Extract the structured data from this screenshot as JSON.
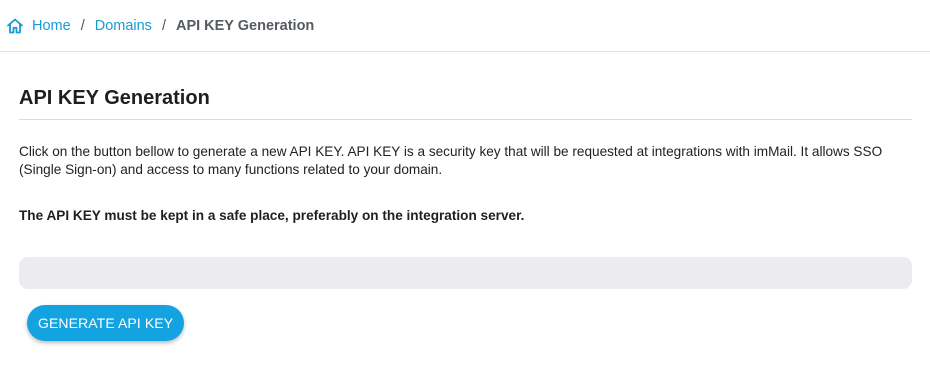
{
  "breadcrumb": {
    "home_label": "Home",
    "home_icon": "home-icon",
    "separator": "/",
    "domains_label": "Domains",
    "current_label": "API KEY Generation"
  },
  "main": {
    "title": "API KEY Generation",
    "description": "Click on the button bellow to generate a new API KEY. API KEY is a security key that will be requested at integrations with imMail. It allows SSO (Single Sign-on) and access to many functions related to your domain.",
    "warning": "The API KEY must be kept in a safe place, preferably on the integration server.",
    "api_key_value": "",
    "generate_button_label": "GENERATE API KEY"
  },
  "colors": {
    "accent": "#14a3e1",
    "link": "#1a9ad6",
    "field_bg": "#ececf0"
  }
}
